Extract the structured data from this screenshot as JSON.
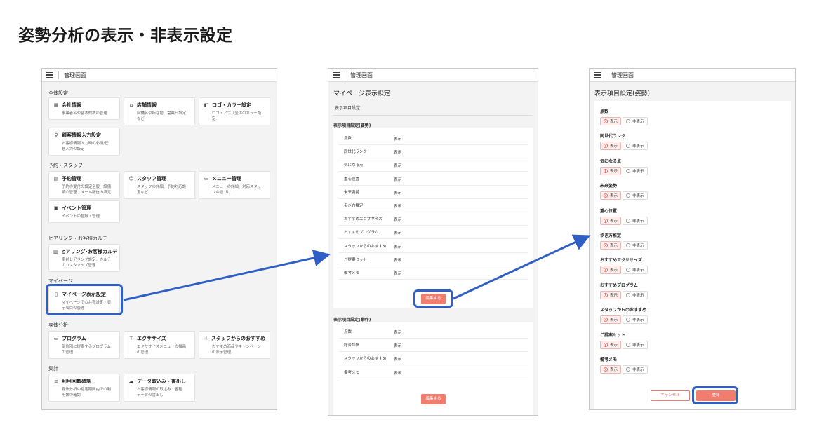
{
  "page": {
    "title": "姿勢分析の表示・非表示設定"
  },
  "accent_color": "#f07d6e",
  "highlight_color": "#2f5fc4",
  "panel1": {
    "topbar_title": "管理画面",
    "sections": [
      {
        "title": "全体設定",
        "cards": [
          {
            "icon": "building-icon",
            "title": "会社情報",
            "desc": "事業者名や基本的教の管理"
          },
          {
            "icon": "store-icon",
            "title": "店舗情報",
            "desc": "店舗名や所在地、営業日設定\nなど"
          },
          {
            "icon": "palette-icon",
            "title": "ロゴ・カラー設定",
            "desc": "ロゴ・アプリ全体のカラー設\n定"
          },
          {
            "icon": "person-edit-icon",
            "title": "顧客情報入力設定",
            "desc": "お客様情報入力時の必須/任\n意入力の設定"
          }
        ]
      },
      {
        "title": "予約・スタッフ",
        "cards": [
          {
            "icon": "calendar-icon",
            "title": "予約管理",
            "desc": "予約の受付の設定全般、設備\n類の管理、メール配信の設定"
          },
          {
            "icon": "staff-icon",
            "title": "スタッフ管理",
            "desc": "スタッフの詳細、予約対応設\n定など"
          },
          {
            "icon": "menu-icon",
            "title": "メニュー管理",
            "desc": "メニューの詳細、対応スタッ\nフの紐づけ"
          },
          {
            "icon": "event-icon",
            "title": "イベント管理",
            "desc": "イベントの登録・管理"
          }
        ]
      },
      {
        "title": "ヒアリング・お客様カルテ",
        "cards": [
          {
            "icon": "clipboard-icon",
            "title": "ヒアリング･お客様カルテ",
            "desc": "事前ヒアリング設定、カルテ\nのカスタマイズ管理"
          }
        ]
      },
      {
        "title": "マイページ",
        "cards": [
          {
            "icon": "phone-icon",
            "title": "マイページ表示設定",
            "desc": "マイページでの共有設定・表\n示項目の管理"
          }
        ]
      },
      {
        "title": "身体分析",
        "cards": [
          {
            "icon": "program-icon",
            "title": "プログラム",
            "desc": "部位別に提案するプログラム\nの管理"
          },
          {
            "icon": "exercise-icon",
            "title": "エクササイズ",
            "desc": "エクササイズメニューの描画\nの管理"
          },
          {
            "icon": "thumbs-up-icon",
            "title": "スタッフからのおすすめ",
            "desc": "おすすめ商品やキャンペーン\nの表示管理"
          }
        ]
      },
      {
        "title": "集計",
        "cards": [
          {
            "icon": "chart-icon",
            "title": "利用回数確認",
            "desc": "身体分析の指定期間内での利\n用数の確認"
          },
          {
            "icon": "cloud-icon",
            "title": "データ取込み・書出し",
            "desc": "お客様情報の取込み・各種\nデータの書出し"
          }
        ]
      }
    ]
  },
  "panel2": {
    "topbar_title": "管理画面",
    "title": "マイページ表示設定",
    "tab": "表示項目設定",
    "posture_section": "表示項目設定(姿勢)",
    "posture_rows": [
      {
        "label": "点数",
        "value": "表示"
      },
      {
        "label": "同世代ランク",
        "value": "表示"
      },
      {
        "label": "気になる点",
        "value": "表示"
      },
      {
        "label": "重心位置",
        "value": "表示"
      },
      {
        "label": "未来姿勢",
        "value": "表示"
      },
      {
        "label": "歩き方推定",
        "value": "表示"
      },
      {
        "label": "おすすめエクササイズ",
        "value": "表示"
      },
      {
        "label": "おすすめプログラム",
        "value": "表示"
      },
      {
        "label": "スタッフからのおすすめ",
        "value": "表示"
      },
      {
        "label": "ご提案セット",
        "value": "表示"
      },
      {
        "label": "備考メモ",
        "value": "表示"
      }
    ],
    "edit_button": "編集する",
    "motion_section": "表示項目設定(動作)",
    "motion_rows": [
      {
        "label": "点数",
        "value": "表示"
      },
      {
        "label": "総合評価",
        "value": "表示"
      },
      {
        "label": "スタッフからのおすすめ",
        "value": "表示"
      },
      {
        "label": "備考メモ",
        "value": "表示"
      }
    ],
    "edit_button2": "編集する"
  },
  "panel3": {
    "topbar_title": "管理画面",
    "title": "表示項目設定(姿勢)",
    "show_label": "表示",
    "hide_label": "非表示",
    "items": [
      {
        "label": "点数",
        "selected": "show"
      },
      {
        "label": "同世代ランク",
        "selected": "show"
      },
      {
        "label": "気になる点",
        "selected": "show"
      },
      {
        "label": "未来姿勢",
        "selected": "show"
      },
      {
        "label": "重心位置",
        "selected": "show"
      },
      {
        "label": "歩き方推定",
        "selected": "show"
      },
      {
        "label": "おすすめエクササイズ",
        "selected": "show"
      },
      {
        "label": "おすすめプログラム",
        "selected": "show"
      },
      {
        "label": "スタッフからのおすすめ",
        "selected": "show"
      },
      {
        "label": "ご提案セット",
        "selected": "show"
      },
      {
        "label": "備考メモ",
        "selected": "show"
      }
    ],
    "cancel_button": "キャンセル",
    "save_button": "登録"
  }
}
